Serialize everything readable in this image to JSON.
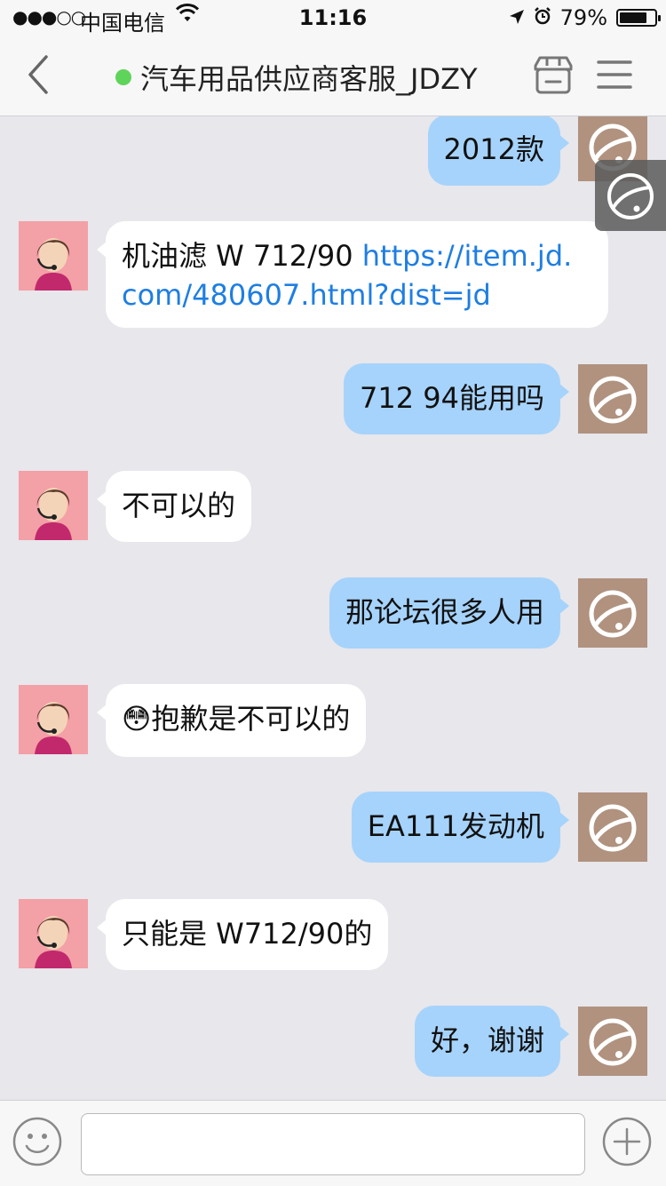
{
  "status_bar": {
    "signal": "●●●○○",
    "carrier": "中国电信",
    "time": "11:16",
    "battery": "79%",
    "battery_level": 0.79
  },
  "header": {
    "title": "汽车用品供应商客服_JDZY",
    "online_color": "#5fd45b"
  },
  "messages": [
    {
      "side": "right",
      "text": "2012款"
    },
    {
      "side": "left",
      "text": "机油滤  W 712/90  ",
      "link_line1": "https://item.jd.",
      "link_line2": "com/480607.html?dist=jd"
    },
    {
      "side": "right",
      "text": "712 94能用吗"
    },
    {
      "side": "left",
      "text": "不可以的"
    },
    {
      "side": "right",
      "text": "那论坛很多人用"
    },
    {
      "side": "left",
      "emoji": "😳",
      "text": "抱歉是不可以的"
    },
    {
      "side": "right",
      "text": "EA111发动机"
    },
    {
      "side": "left",
      "text": "只能是  W712/90的"
    },
    {
      "side": "right",
      "text": "好，谢谢"
    }
  ],
  "input": {
    "placeholder": "",
    "value": ""
  },
  "colors": {
    "my_bubble": "#a6d3fb",
    "agent_bubble": "#ffffff",
    "background": "#e7e7ec",
    "link": "#1e7ee2"
  }
}
